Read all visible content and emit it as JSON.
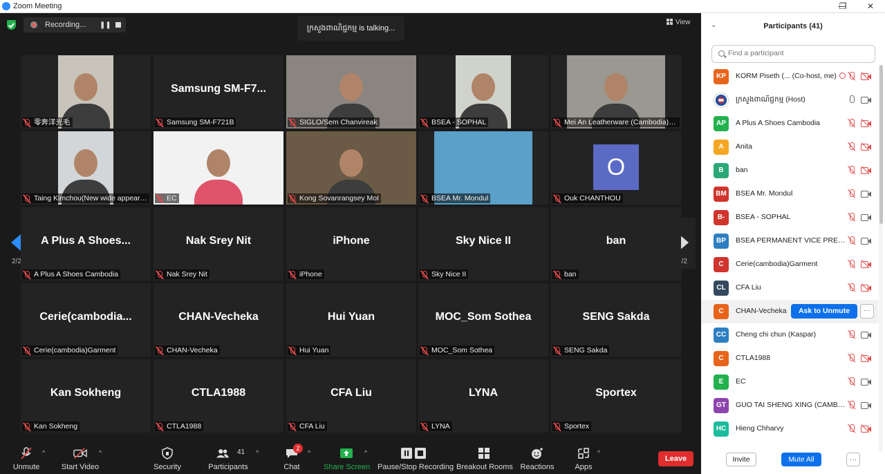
{
  "window": {
    "title": "Zoom Meeting",
    "minimize": "—",
    "maximize": "❐",
    "close": "✕"
  },
  "topbar": {
    "recording_label": "Recording...",
    "talking": "ក្រសួងពាណិជ្ជកម្ម is talking...",
    "view_label": "View"
  },
  "paging": {
    "left_page": "2/2",
    "right_page": "2/2"
  },
  "tiles": [
    {
      "label": "零奔洋光毛",
      "type": "video",
      "bg": "#c9c4bb"
    },
    {
      "name": "Samsung  SM-F7...",
      "label": "Samsung SM-F721B",
      "type": "name"
    },
    {
      "label": "SIGLO/Sem Chanvireak",
      "type": "video",
      "bg": "#8a8580"
    },
    {
      "label": "BSEA - SOPHAL",
      "type": "video",
      "bg": "#cfd3cc"
    },
    {
      "label": "Mei An Leatherware (Cambodia) C...",
      "type": "video",
      "bg": "#9a9890"
    },
    {
      "label": "Taing Kimchou(New wide appeared...",
      "type": "video",
      "bg": "#d3d6d8"
    },
    {
      "label": "EC",
      "type": "video",
      "bg": "#f2f2f2"
    },
    {
      "label": "Kong Sovanrangsey MoI",
      "type": "video",
      "bg": "#6b5a45"
    },
    {
      "label": "BSEA  Mr. Mondul",
      "type": "video",
      "bg": "#5aa0c8"
    },
    {
      "label": "Ouk CHANTHOU",
      "type": "avatar",
      "initial": "O"
    },
    {
      "name": "A Plus A Shoes...",
      "label": "A Plus A Shoes Cambodia",
      "type": "name"
    },
    {
      "name": "Nak Srey Nit",
      "label": "Nak Srey Nit",
      "type": "name"
    },
    {
      "name": "iPhone",
      "label": "iPhone",
      "type": "name"
    },
    {
      "name": "Sky Nice II",
      "label": "Sky Nice II",
      "type": "name"
    },
    {
      "name": "ban",
      "label": "ban",
      "type": "name"
    },
    {
      "name": "Cerie(cambodia...",
      "label": "Cerie(cambodia)Garment",
      "type": "name"
    },
    {
      "name": "CHAN-Vecheka",
      "label": "CHAN-Vecheka",
      "type": "name"
    },
    {
      "name": "Hui Yuan",
      "label": "Hui Yuan",
      "type": "name"
    },
    {
      "name": "MOC_Som Sothea",
      "label": "MOC_Som Sothea",
      "type": "name"
    },
    {
      "name": "SENG Sakda",
      "label": "SENG Sakda",
      "type": "name"
    },
    {
      "name": "Kan Sokheng",
      "label": "Kan Sokheng",
      "type": "name"
    },
    {
      "name": "CTLA1988",
      "label": "CTLA1988",
      "type": "name"
    },
    {
      "name": "CFA Liu",
      "label": "CFA Liu",
      "type": "name"
    },
    {
      "name": "LYNA",
      "label": "LYNA",
      "type": "name"
    },
    {
      "name": "Sportex",
      "label": "Sportex",
      "type": "name"
    }
  ],
  "controls": {
    "unmute": "Unmute",
    "start_video": "Start Video",
    "security": "Security",
    "participants": "Participants",
    "participants_count": "41",
    "chat": "Chat",
    "chat_badge": "2",
    "share_screen": "Share Screen",
    "pause_recording": "Pause/Stop Recording",
    "breakout": "Breakout Rooms",
    "reactions": "Reactions",
    "apps": "Apps",
    "leave": "Leave",
    "share_color": "#22b14c",
    "leave_color": "#e02d2d"
  },
  "panel": {
    "title": "Participants (41)",
    "search_placeholder": "Find a participant",
    "ask_to_unmute": "Ask to Unmute",
    "more": "···",
    "invite": "Invite",
    "mute_all": "Mute All",
    "participants": [
      {
        "initials": "KP",
        "color": "#e8641b",
        "name": "KORM Piseth (... (Co-host, me)",
        "mic": "off",
        "cam": "off",
        "cohost": true
      },
      {
        "initials": "",
        "color": "#ffffff",
        "name": "ក្រសួងពាណិជ្ជកម្ម (Host)",
        "mic": "on",
        "cam": "on",
        "logo": true
      },
      {
        "initials": "AP",
        "color": "#22b14c",
        "name": "A Plus A Shoes Cambodia",
        "mic": "off",
        "cam": "off"
      },
      {
        "initials": "A",
        "color": "#f5a623",
        "name": "Anita",
        "mic": "off",
        "cam": "off"
      },
      {
        "initials": "B",
        "color": "#2aa876",
        "name": "ban",
        "mic": "off",
        "cam": "off"
      },
      {
        "initials": "BM",
        "color": "#d0342c",
        "name": "BSEA  Mr. Mondul",
        "mic": "off",
        "cam": "on"
      },
      {
        "initials": "B-",
        "color": "#d0342c",
        "name": "BSEA - SOPHAL",
        "mic": "off",
        "cam": "on"
      },
      {
        "initials": "BP",
        "color": "#2d7fc1",
        "name": "BSEA PERMANENT VICE PRESIDE...",
        "mic": "off",
        "cam": "on"
      },
      {
        "initials": "C",
        "color": "#d0342c",
        "name": "Cerie(cambodia)Garment",
        "mic": "off",
        "cam": "off"
      },
      {
        "initials": "CL",
        "color": "#34495e",
        "name": "CFA Liu",
        "mic": "off",
        "cam": "off"
      },
      {
        "initials": "C",
        "color": "#e8641b",
        "name": "CHAN-Vecheka",
        "mic": "off",
        "cam": "off",
        "highlight": true
      },
      {
        "initials": "CC",
        "color": "#2d7fc1",
        "name": "Cheng chi chun (Kaspar)",
        "mic": "off",
        "cam": "on"
      },
      {
        "initials": "C",
        "color": "#e8641b",
        "name": "CTLA1988",
        "mic": "off",
        "cam": "off"
      },
      {
        "initials": "E",
        "color": "#22b14c",
        "name": "EC",
        "mic": "off",
        "cam": "on"
      },
      {
        "initials": "GT",
        "color": "#8e44ad",
        "name": "GUO TAI SHENG XING (CAMBOD...",
        "mic": "off",
        "cam": "on"
      },
      {
        "initials": "HC",
        "color": "#1abc9c",
        "name": "Hieng Chharvy",
        "mic": "off",
        "cam": "off"
      }
    ]
  }
}
